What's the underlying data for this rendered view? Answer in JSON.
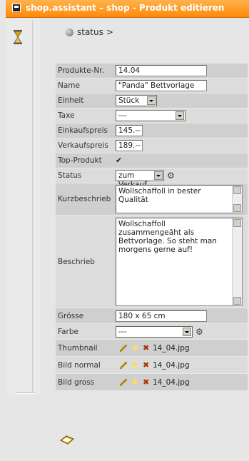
{
  "window": {
    "title": "shop.assistant – shop - Produkt editieren"
  },
  "breadcrumb": {
    "item": "status",
    "separator": ">"
  },
  "form": {
    "produkte_nr": {
      "label": "Produkte-Nr.",
      "value": "14.04"
    },
    "name": {
      "label": "Name",
      "value": "\"Panda\" Bettvorlage"
    },
    "einheit": {
      "label": "Einheit",
      "value": "Stück"
    },
    "taxe": {
      "label": "Taxe",
      "value": "---"
    },
    "einkaufspreis": {
      "label": "Einkaufspreis",
      "value": "145.--"
    },
    "verkaufspreis": {
      "label": "Verkaufspreis",
      "value": "189.--"
    },
    "top_produkt": {
      "label": "Top-Produkt",
      "checked": "✔"
    },
    "status": {
      "label": "Status",
      "value": "zum Verkauf"
    },
    "kurzbeschrieb": {
      "label": "Kurzbeschrieb",
      "value": "Wollschaffoll in bester Qualität"
    },
    "beschrieb": {
      "label": "Beschrieb",
      "value": "Wollschaffoll zusammengeäht als Bettvorlage. So steht man morgens gerne auf!"
    },
    "groesse": {
      "label": "Grösse",
      "value": "180 x 65 cm"
    },
    "farbe": {
      "label": "Farbe",
      "value": "---"
    },
    "thumbnail": {
      "label": "Thumbnail",
      "file": "14_04.jpg"
    },
    "bild_normal": {
      "label": "Bild normal",
      "file": "14_04.jpg"
    },
    "bild_gross": {
      "label": "Bild gross",
      "file": "14_04.jpg"
    }
  },
  "icons": {
    "window": "window-icon",
    "hourglass": "hourglass-icon",
    "status_dot": "status-dot-icon",
    "status_tool": "wrench-icon",
    "farbe_tool": "wrench-icon",
    "edit": "pencil-icon",
    "preview": "bulb-icon",
    "delete": "delete-icon",
    "bottom": "save-icon"
  },
  "colors": {
    "titlebar": "#ff8a0a",
    "row_odd": "#cfcfcf",
    "row_even": "#dcdcdc"
  }
}
